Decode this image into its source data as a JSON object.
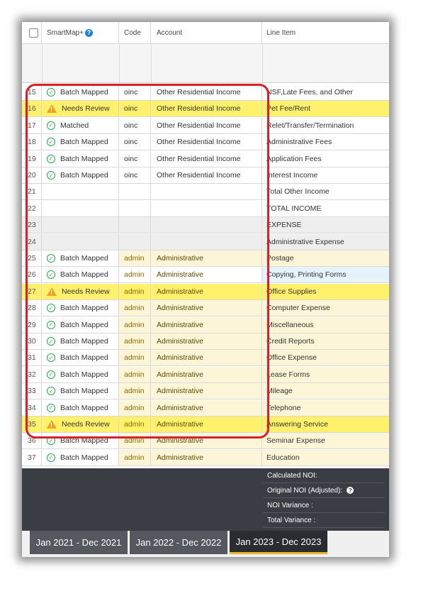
{
  "header": {
    "smartmap_label": "SmartMap+",
    "code_label": "Code",
    "account_label": "Account",
    "line_item_label": "Line Item"
  },
  "rows": [
    {
      "num": "15",
      "status": "Batch Mapped",
      "icon": "ok",
      "code": "oinc",
      "account": "Other Residential Income",
      "line": "NSF,Late Fees, and Other",
      "style": "plain"
    },
    {
      "num": "16",
      "status": "Needs Review",
      "icon": "warn",
      "code": "oinc",
      "account": "Other Residential Income",
      "line": "Pet Fee/Rent",
      "style": "yellow"
    },
    {
      "num": "17",
      "status": "Matched",
      "icon": "ok",
      "code": "oinc",
      "account": "Other Residential Income",
      "line": "Relet/Transfer/Termination",
      "style": "plain"
    },
    {
      "num": "18",
      "status": "Batch Mapped",
      "icon": "ok",
      "code": "oinc",
      "account": "Other Residential Income",
      "line": "Administrative Fees",
      "style": "plain"
    },
    {
      "num": "19",
      "status": "Batch Mapped",
      "icon": "ok",
      "code": "oinc",
      "account": "Other Residential Income",
      "line": "Application Fees",
      "style": "plain"
    },
    {
      "num": "20",
      "status": "Batch Mapped",
      "icon": "ok",
      "code": "oinc",
      "account": "Other Residential Income",
      "line": "Interest Income",
      "style": "plain"
    },
    {
      "num": "21",
      "status": "",
      "icon": "",
      "code": "",
      "account": "",
      "line": "Total Other Income",
      "style": "plain"
    },
    {
      "num": "22",
      "status": "",
      "icon": "",
      "code": "",
      "account": "",
      "line": "TOTAL INCOME",
      "style": "plain"
    },
    {
      "num": "23",
      "status": "",
      "icon": "",
      "code": "",
      "account": "",
      "line": "EXPENSE",
      "style": "gray"
    },
    {
      "num": "24",
      "status": "",
      "icon": "",
      "code": "",
      "account": "",
      "line": "Administrative Expense",
      "style": "gray"
    },
    {
      "num": "25",
      "status": "Batch Mapped",
      "icon": "ok",
      "code": "admin",
      "account": "Administrative",
      "line": "Postage",
      "style": "cream"
    },
    {
      "num": "26",
      "status": "Batch Mapped",
      "icon": "ok",
      "code": "admin",
      "account": "Administrative",
      "line": "Copying, Printing Forms",
      "style": "blue"
    },
    {
      "num": "27",
      "status": "Needs Review",
      "icon": "warn",
      "code": "admin",
      "account": "Administrative",
      "line": "Office Supplies",
      "style": "yellow"
    },
    {
      "num": "28",
      "status": "Batch Mapped",
      "icon": "ok",
      "code": "admin",
      "account": "Administrative",
      "line": "Computer Expense",
      "style": "cream"
    },
    {
      "num": "29",
      "status": "Batch Mapped",
      "icon": "ok",
      "code": "admin",
      "account": "Administrative",
      "line": "Miscellaneous",
      "style": "cream"
    },
    {
      "num": "30",
      "status": "Batch Mapped",
      "icon": "ok",
      "code": "admin",
      "account": "Administrative",
      "line": "Credit Reports",
      "style": "cream"
    },
    {
      "num": "31",
      "status": "Batch Mapped",
      "icon": "ok",
      "code": "admin",
      "account": "Administrative",
      "line": "Office Expense",
      "style": "cream"
    },
    {
      "num": "32",
      "status": "Batch Mapped",
      "icon": "ok",
      "code": "admin",
      "account": "Administrative",
      "line": "Lease Forms",
      "style": "cream"
    },
    {
      "num": "33",
      "status": "Batch Mapped",
      "icon": "ok",
      "code": "admin",
      "account": "Administrative",
      "line": "Mileage",
      "style": "cream"
    },
    {
      "num": "34",
      "status": "Batch Mapped",
      "icon": "ok",
      "code": "admin",
      "account": "Administrative",
      "line": "Telephone",
      "style": "cream"
    },
    {
      "num": "35",
      "status": "Needs Review",
      "icon": "warn",
      "code": "admin",
      "account": "Administrative",
      "line": "Answering Service",
      "style": "yellow"
    },
    {
      "num": "36",
      "status": "Batch Mapped",
      "icon": "ok",
      "code": "admin",
      "account": "Administrative",
      "line": "Seminar Expense",
      "style": "cream"
    },
    {
      "num": "37",
      "status": "Batch Mapped",
      "icon": "ok",
      "code": "admin",
      "account": "Administrative",
      "line": "Education",
      "style": "cream"
    }
  ],
  "summary": {
    "calculated_noi": "Calculated NOI:",
    "original_noi": "Original NOI (Adjusted):",
    "noi_variance": "NOI Variance :",
    "total_variance": "Total Variance :"
  },
  "tabs": [
    {
      "label": "Jan 2021 - Dec 2021",
      "active": false
    },
    {
      "label": "Jan 2022 - Dec 2022",
      "active": false
    },
    {
      "label": "Jan 2023 - Dec 2023",
      "active": true
    }
  ],
  "colors": {
    "needs_review": "#fff16b",
    "matched_icon": "#2ea84a",
    "warning_icon": "#f0a020",
    "highlight": "#d9202a",
    "active_tab_accent": "#e8b52a"
  }
}
